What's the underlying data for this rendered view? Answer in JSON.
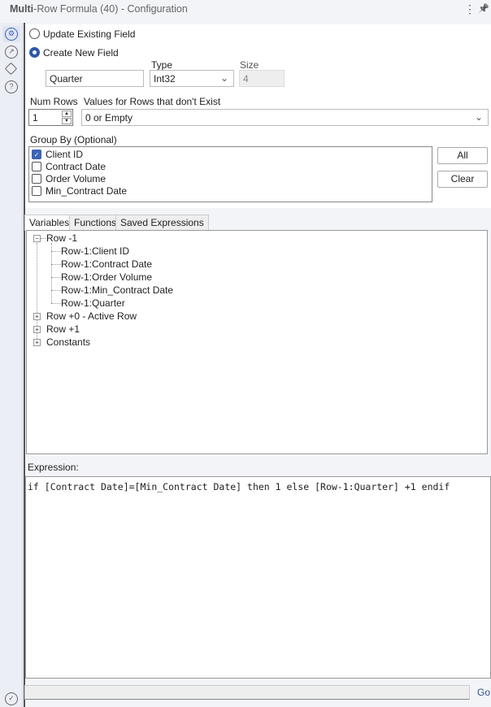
{
  "window": {
    "title_bold": "Multi",
    "title_rest": "-Row Formula (40) - Configuration",
    "more_icon": "⋮",
    "pin_icon": "📌"
  },
  "rail": {
    "icons": [
      "gear-icon",
      "connection-icon",
      "tag-icon",
      "help-icon",
      "check-circle-icon"
    ]
  },
  "config": {
    "update_existing_label": "Update Existing Field",
    "create_new_label": "Create New  Field",
    "field_name": "Quarter",
    "type_label": "Type",
    "type_value": "Int32",
    "size_label": "Size",
    "size_value": "4",
    "num_rows_label": "Num Rows",
    "num_rows_value": "1",
    "values_label": "Values for Rows that don't Exist",
    "values_value": "0 or Empty",
    "group_by_label": "Group By (Optional)",
    "group_by": [
      {
        "label": "Client ID",
        "checked": true
      },
      {
        "label": "Contract Date",
        "checked": false
      },
      {
        "label": "Order Volume",
        "checked": false
      },
      {
        "label": "Min_Contract Date",
        "checked": false
      }
    ],
    "all_button": "All",
    "clear_button": "Clear"
  },
  "tabs": [
    "Variables",
    "Functions",
    "Saved Expressions"
  ],
  "tree": {
    "row_minus1": "Row -1",
    "children": [
      "Row-1:Client ID",
      "Row-1:Contract Date",
      "Row-1:Order Volume",
      "Row-1:Min_Contract Date",
      "Row-1:Quarter"
    ],
    "row0": "Row +0 - Active Row",
    "row1": "Row +1",
    "constants": "Constants"
  },
  "expression": {
    "label": "Expression:",
    "text": "if [Contract Date]=[Min_Contract Date] then 1 else [Row-1:Quarter] +1 endif"
  },
  "go_label": "Go"
}
